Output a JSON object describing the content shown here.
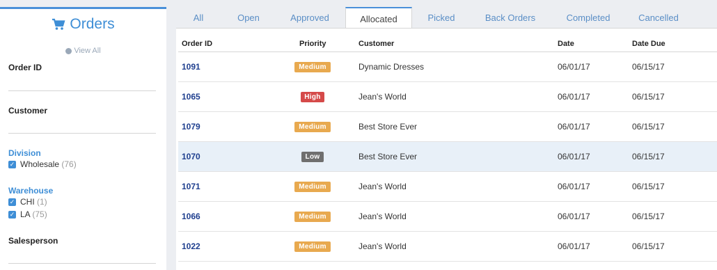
{
  "sidebar": {
    "title": "Orders",
    "view_all": "View All",
    "order_id_label": "Order ID",
    "customer_label": "Customer",
    "division": {
      "label": "Division",
      "options": [
        {
          "name": "Wholesale",
          "count": "(76)",
          "checked": true
        }
      ]
    },
    "warehouse": {
      "label": "Warehouse",
      "options": [
        {
          "name": "CHI",
          "count": "(1)",
          "checked": true
        },
        {
          "name": "LA",
          "count": "(75)",
          "checked": true
        }
      ]
    },
    "salesperson_label": "Salesperson"
  },
  "tabs": [
    "All",
    "Open",
    "Approved",
    "Allocated",
    "Picked",
    "Back Orders",
    "Completed",
    "Cancelled"
  ],
  "active_tab": "Allocated",
  "table": {
    "headers": {
      "order_id": "Order ID",
      "priority": "Priority",
      "customer": "Customer",
      "date": "Date",
      "date_due": "Date Due"
    },
    "rows": [
      {
        "order_id": "1091",
        "priority": "Medium",
        "customer": "Dynamic Dresses",
        "date": "06/01/17",
        "date_due": "06/15/17"
      },
      {
        "order_id": "1065",
        "priority": "High",
        "customer": "Jean's World",
        "date": "06/01/17",
        "date_due": "06/15/17"
      },
      {
        "order_id": "1079",
        "priority": "Medium",
        "customer": "Best Store Ever",
        "date": "06/01/17",
        "date_due": "06/15/17"
      },
      {
        "order_id": "1070",
        "priority": "Low",
        "customer": "Best Store Ever",
        "date": "06/01/17",
        "date_due": "06/15/17"
      },
      {
        "order_id": "1071",
        "priority": "Medium",
        "customer": "Jean's World",
        "date": "06/01/17",
        "date_due": "06/15/17"
      },
      {
        "order_id": "1066",
        "priority": "Medium",
        "customer": "Jean's World",
        "date": "06/01/17",
        "date_due": "06/15/17"
      },
      {
        "order_id": "1022",
        "priority": "Medium",
        "customer": "Jean's World",
        "date": "06/01/17",
        "date_due": "06/15/17"
      }
    ]
  },
  "colors": {
    "accent": "#3e8ed6",
    "medium": "#e8a94f",
    "high": "#d54a49",
    "low": "#6f6f6f",
    "order_id": "#1f3f8f",
    "highlight_row": "#e8f0f8"
  },
  "icons": {
    "title": "shopping-cart-icon",
    "view_all": "globe-icon",
    "checkbox": "checkbox-checked-icon"
  }
}
